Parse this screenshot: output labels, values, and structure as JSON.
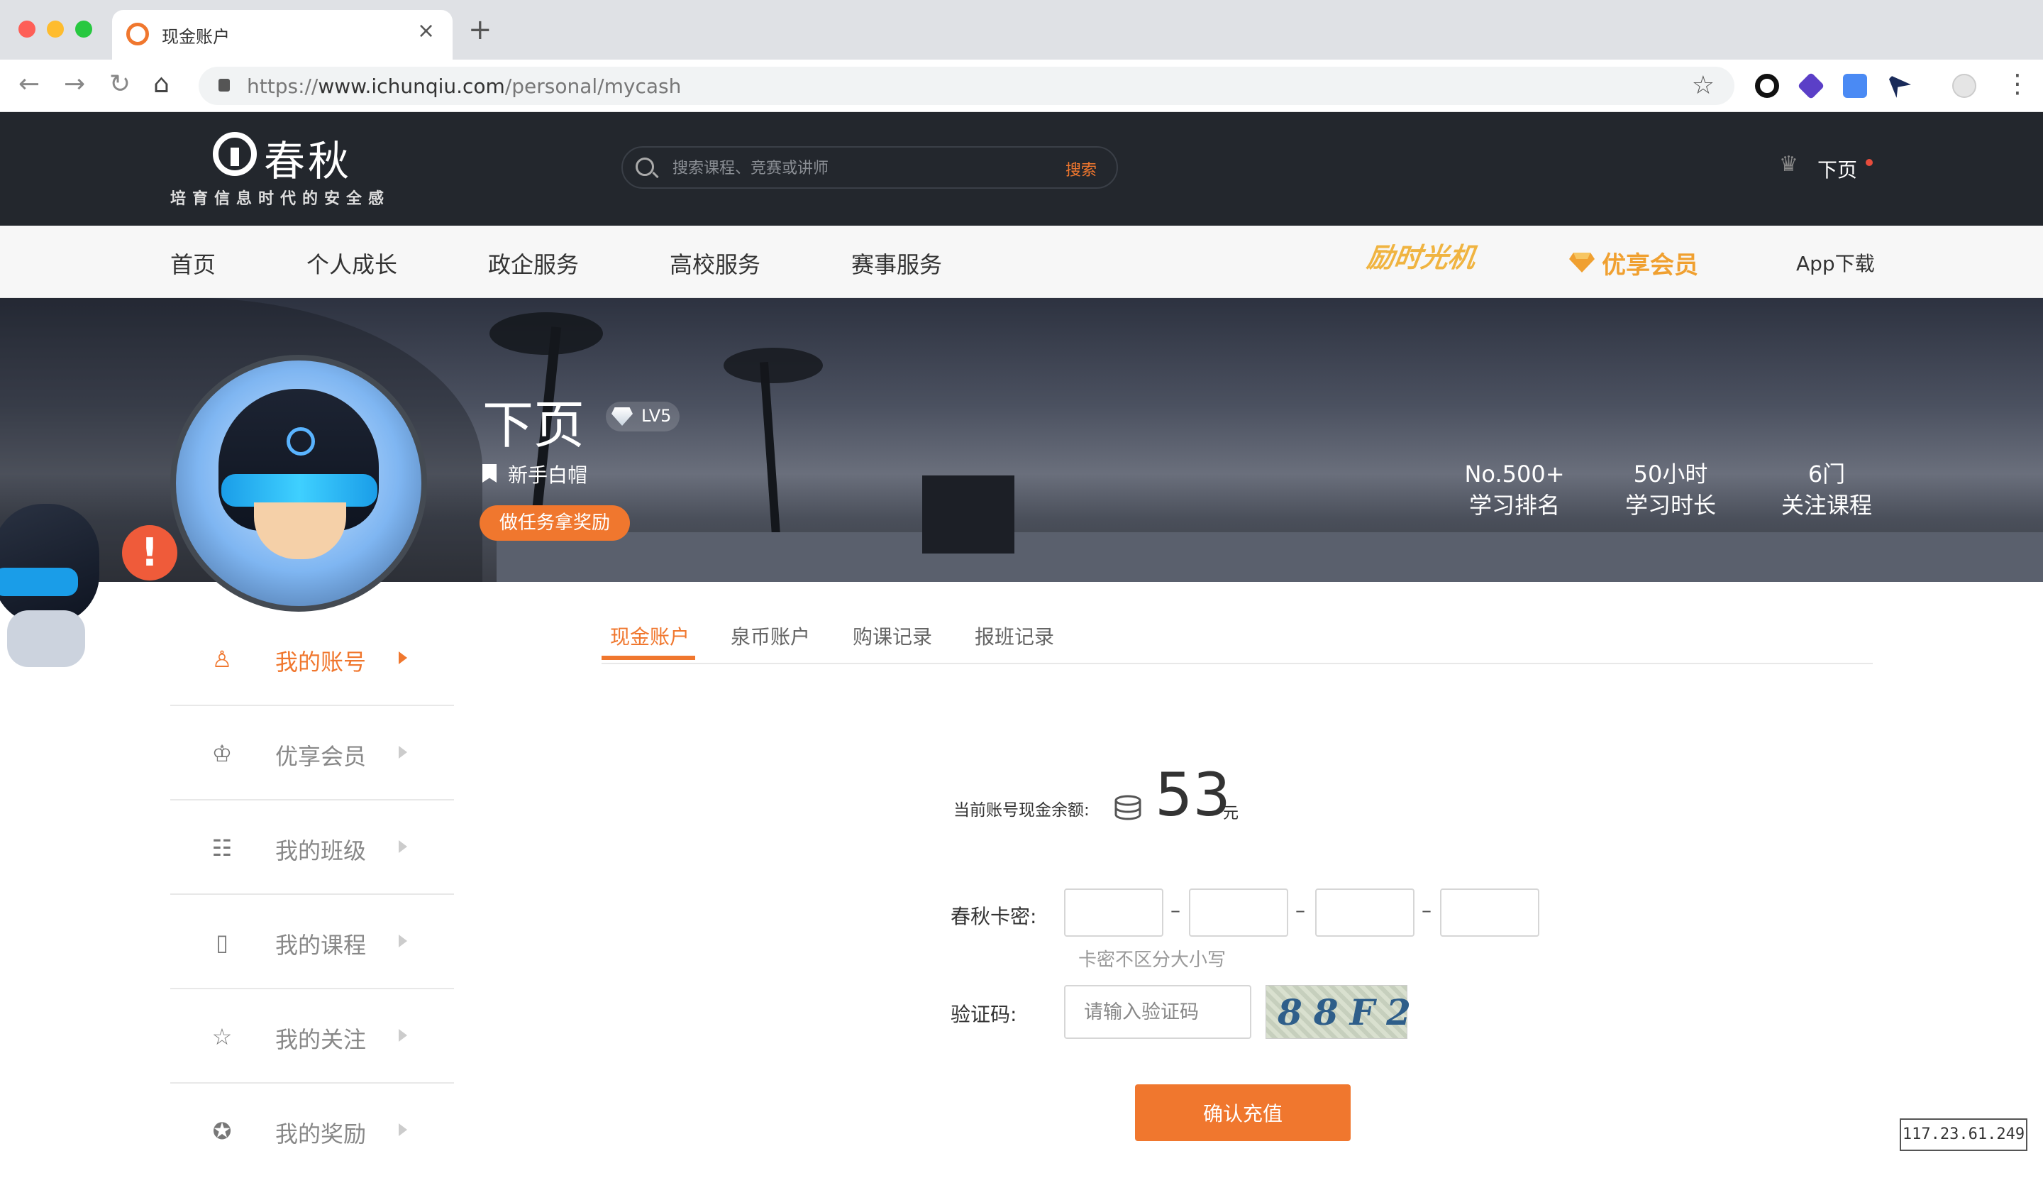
{
  "browser": {
    "tab_title": "现金账户",
    "url_prefix": "https://",
    "url_host": "www.ichunqiu.com",
    "url_path": "/personal/mycash"
  },
  "header": {
    "logo_text": "春秋",
    "logo_slogan": "培育信息时代的安全感",
    "search_placeholder": "搜索课程、竞赛或讲师",
    "search_button": "搜索",
    "user_name": "下页"
  },
  "nav": {
    "items": [
      "首页",
      "个人成长",
      "政企服务",
      "高校服务",
      "赛事服务"
    ],
    "promo": "励时光机",
    "vip": "优享会员",
    "app": "App下载"
  },
  "profile": {
    "name": "下页",
    "level": "LV5",
    "rank_title": "新手白帽",
    "task_button": "做任务拿奖励",
    "alert": "!",
    "stats": [
      {
        "value": "No.500+",
        "label": "学习排名"
      },
      {
        "value": "50小时",
        "label": "学习时长"
      },
      {
        "value": "6门",
        "label": "关注课程"
      }
    ]
  },
  "sidebar": {
    "items": [
      {
        "label": "我的账号",
        "icon": "user-icon"
      },
      {
        "label": "优享会员",
        "icon": "crown-icon"
      },
      {
        "label": "我的班级",
        "icon": "class-icon"
      },
      {
        "label": "我的课程",
        "icon": "book-icon"
      },
      {
        "label": "我的关注",
        "icon": "star-icon"
      },
      {
        "label": "我的奖励",
        "icon": "award-icon"
      }
    ]
  },
  "tabs": [
    "现金账户",
    "泉币账户",
    "购课记录",
    "报班记录"
  ],
  "account": {
    "balance_label": "当前账号现金余额:",
    "balance_value": "53",
    "balance_unit": "元",
    "card_label": "春秋卡密:",
    "card_hint": "卡密不区分大小写",
    "captcha_label": "验证码:",
    "captcha_placeholder": "请输入验证码",
    "captcha_code": "88F2",
    "confirm_button": "确认充值"
  },
  "ip_address": "117.23.61.249",
  "colors": {
    "accent": "#f0772e",
    "header_bg": "#23272d",
    "vip_gold": "#f0a030"
  }
}
